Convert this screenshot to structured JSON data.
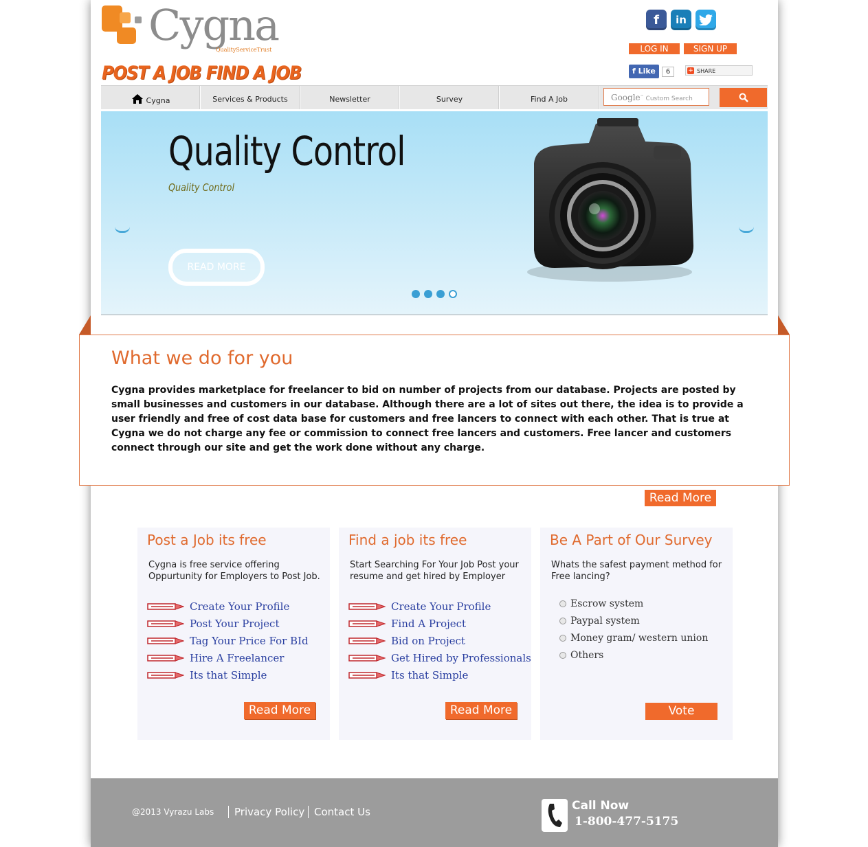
{
  "brand": {
    "logo_text": "Cygna",
    "logo_tagline": "QualityServiceTrust",
    "slogan": "POST A JOB  FIND A JOB",
    "accent_color": "#f06a2c"
  },
  "social": {
    "facebook": "f",
    "linkedin": "in",
    "twitter": "t"
  },
  "auth": {
    "login": "LOG IN",
    "signup": "SIGN UP"
  },
  "fb_like": {
    "label": "Like",
    "count": "6"
  },
  "share": {
    "label": "SHARE"
  },
  "nav": {
    "items": [
      {
        "label": "Cygna"
      },
      {
        "label": "Services & Products"
      },
      {
        "label": "Newsletter"
      },
      {
        "label": "Survey"
      },
      {
        "label": "Find A Job"
      }
    ],
    "search_google": "Google",
    "search_placeholder": "Custom Search"
  },
  "slider": {
    "title": "Quality Control",
    "subtitle": "Quality Control",
    "button": "READ MORE",
    "active_slide": 1,
    "slide_count": 4
  },
  "about": {
    "title": "What we do for you",
    "text": "Cygna provides marketplace for freelancer to bid on number of projects from our database. Projects are posted by small businesses and customers in our database. Although there are a lot of sites out there, the idea is to provide a user friendly and free of cost data base for customers and free lancers to connect with each other. That is true at Cygna we do not charge any fee or commission to connect free lancers and customers. Free lancer and customers connect through our site and get the work done without any charge.",
    "read_more": "Read More"
  },
  "columns": {
    "post": {
      "title": "Post a Job its free",
      "desc": "Cygna is free service offering Oppurtunity for Employers to Post Job.",
      "links": [
        "Create Your Profile",
        "Post Your Project",
        "Tag Your Price For BId",
        "Hire A Freelancer",
        "Its that Simple"
      ],
      "read_more": "Read More"
    },
    "find": {
      "title": "Find a job its free",
      "desc": "Start Searching For Your Job Post your resume and get hired by Employer",
      "links": [
        "Create Your Profile",
        "Find A Project",
        "Bid on Project",
        "Get Hired by Professionals",
        "Its that Simple"
      ],
      "read_more": "Read More"
    },
    "survey": {
      "title": "Be A Part of Our Survey",
      "question": "Whats the safest payment method for Free lancing?",
      "options": [
        "Escrow system",
        "Paypal system",
        "Money gram/ western union",
        "Others"
      ],
      "vote": "Vote"
    }
  },
  "footer": {
    "copyright": "@2013 Vyrazu Labs",
    "privacy": "Privacy Policy",
    "contact": "Contact Us",
    "call_label": "Call Now",
    "phone": "1-800-477-5175"
  }
}
